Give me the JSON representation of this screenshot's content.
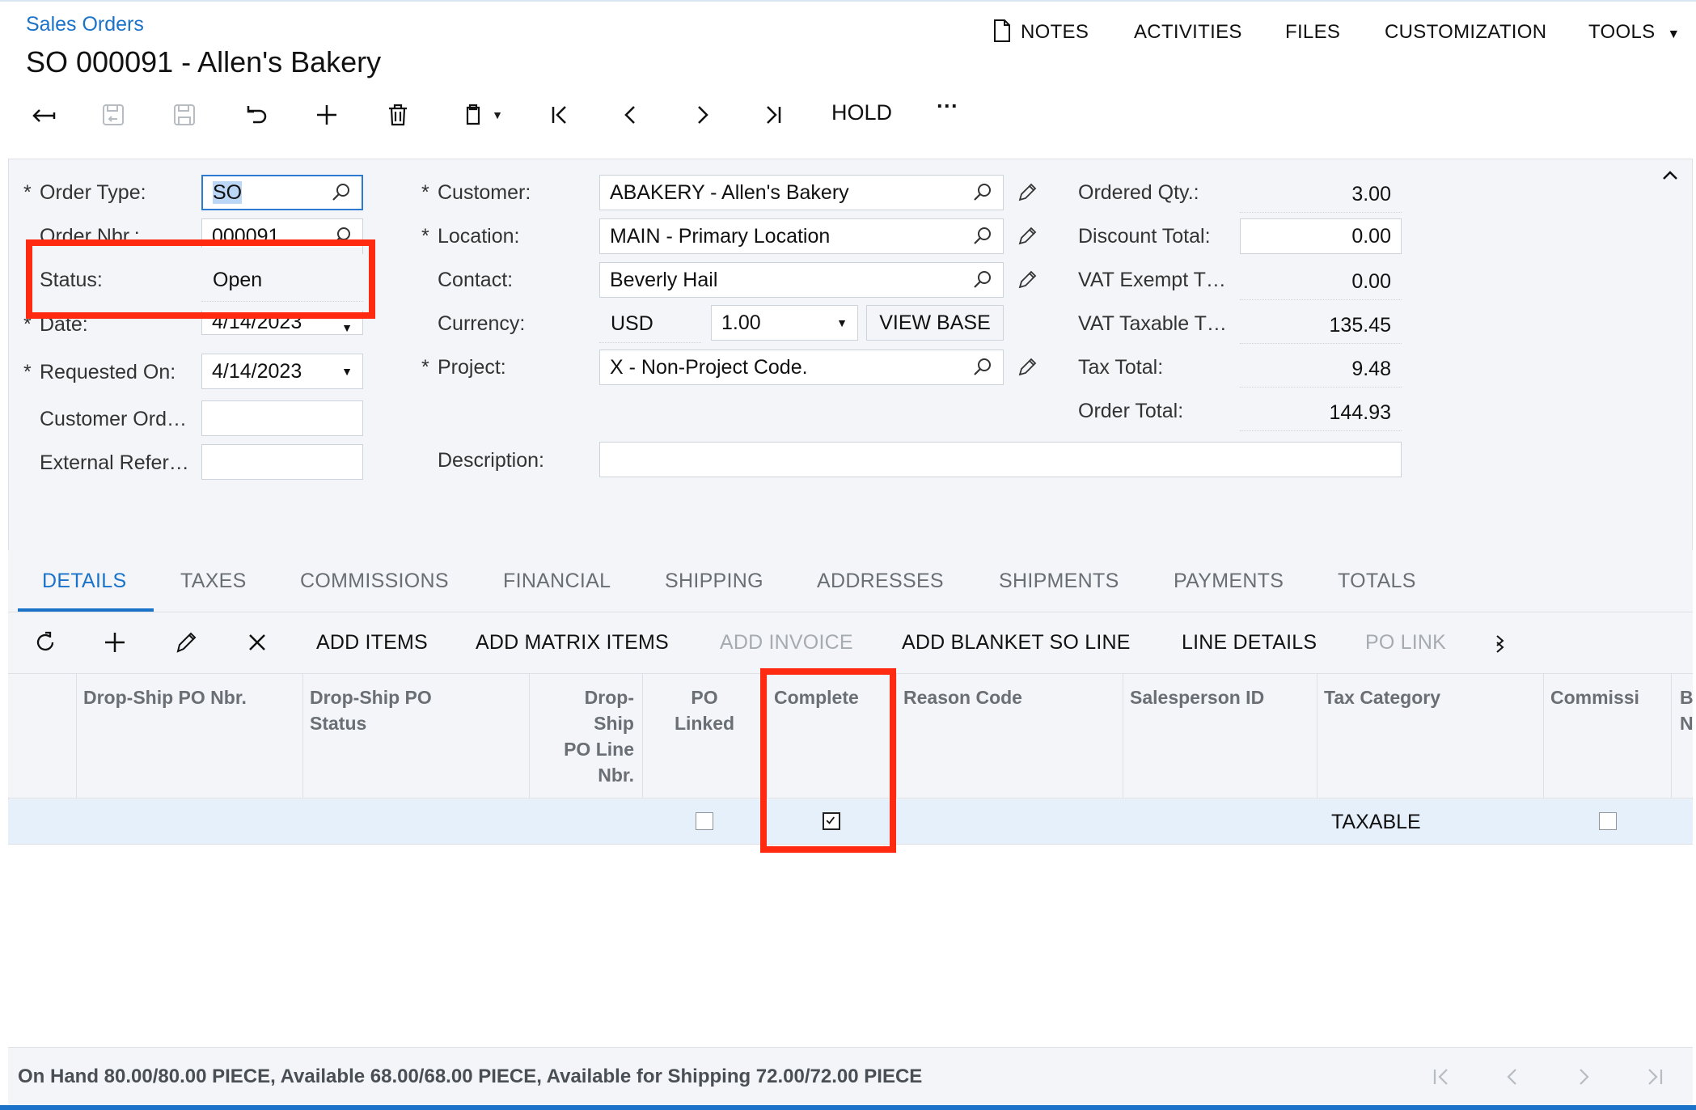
{
  "breadcrumb": "Sales Orders",
  "title": "SO 000091 - Allen's Bakery",
  "top_menu": {
    "notes": "NOTES",
    "activities": "ACTIVITIES",
    "files": "FILES",
    "customization": "CUSTOMIZATION",
    "tools": "TOOLS"
  },
  "toolbar": {
    "hold": "HOLD",
    "more": "···"
  },
  "form": {
    "order_type_label": "Order Type:",
    "order_type": "SO",
    "order_nbr_label": "Order Nbr.:",
    "order_nbr": "000091",
    "status_label": "Status:",
    "status": "Open",
    "date_label": "Date:",
    "date": "4/14/2023",
    "requested_on_label": "Requested On:",
    "requested_on": "4/14/2023",
    "customer_ord_label": "Customer Ord…",
    "customer_ord": "",
    "external_ref_label": "External Refer…",
    "external_ref": "",
    "customer_label": "Customer:",
    "customer": "ABAKERY - Allen's Bakery",
    "location_label": "Location:",
    "location": "MAIN - Primary Location",
    "contact_label": "Contact:",
    "contact": "Beverly Hail",
    "currency_label": "Currency:",
    "currency": "USD",
    "rate": "1.00",
    "view_base": "VIEW BASE",
    "project_label": "Project:",
    "project": "X - Non-Project Code.",
    "description_label": "Description:",
    "description": "",
    "ordered_qty_label": "Ordered Qty.:",
    "ordered_qty": "3.00",
    "discount_total_label": "Discount Total:",
    "discount_total": "0.00",
    "vat_exempt_label": "VAT Exempt T…",
    "vat_exempt": "0.00",
    "vat_taxable_label": "VAT Taxable T…",
    "vat_taxable": "135.45",
    "tax_total_label": "Tax Total:",
    "tax_total": "9.48",
    "order_total_label": "Order Total:",
    "order_total": "144.93"
  },
  "tabs": [
    "DETAILS",
    "TAXES",
    "COMMISSIONS",
    "FINANCIAL",
    "SHIPPING",
    "ADDRESSES",
    "SHIPMENTS",
    "PAYMENTS",
    "TOTALS"
  ],
  "grid_toolbar": {
    "add_items": "ADD ITEMS",
    "add_matrix_items": "ADD MATRIX ITEMS",
    "add_invoice": "ADD INVOICE",
    "add_blanket": "ADD BLANKET SO LINE",
    "line_details": "LINE DETAILS",
    "po_link": "PO LINK"
  },
  "columns": {
    "dropship_po_nbr": "Drop-Ship PO Nbr.",
    "dropship_po_status_1": "Drop-Ship PO",
    "dropship_po_status_2": "Status",
    "dropship_line_1": "Drop-",
    "dropship_line_2": "Ship",
    "dropship_line_3": "PO Line",
    "dropship_line_4": "Nbr.",
    "po_linked_1": "PO",
    "po_linked_2": "Linked",
    "completed": "Complete",
    "reason_code": "Reason Code",
    "salesperson_id": "Salesperson ID",
    "tax_category": "Tax Category",
    "commissionable": "Commissi",
    "extra_1": "B",
    "extra_2": "N"
  },
  "row": {
    "po_linked": false,
    "completed": true,
    "tax_category": "TAXABLE",
    "commissionable": false
  },
  "footer": "On Hand 80.00/80.00 PIECE, Available 68.00/68.00 PIECE, Available for Shipping 72.00/72.00 PIECE",
  "colors": {
    "accent": "#1a73c9",
    "highlight": "#ff2a10",
    "panel": "#f3f5f8"
  },
  "icons": [
    "back-icon",
    "save-close-icon",
    "save-icon",
    "undo-icon",
    "add-icon",
    "delete-icon",
    "copy-paste-icon",
    "first-icon",
    "prev-icon",
    "next-icon",
    "last-icon",
    "search-icon",
    "pencil-icon",
    "refresh-icon",
    "close-icon",
    "expand-icon"
  ]
}
